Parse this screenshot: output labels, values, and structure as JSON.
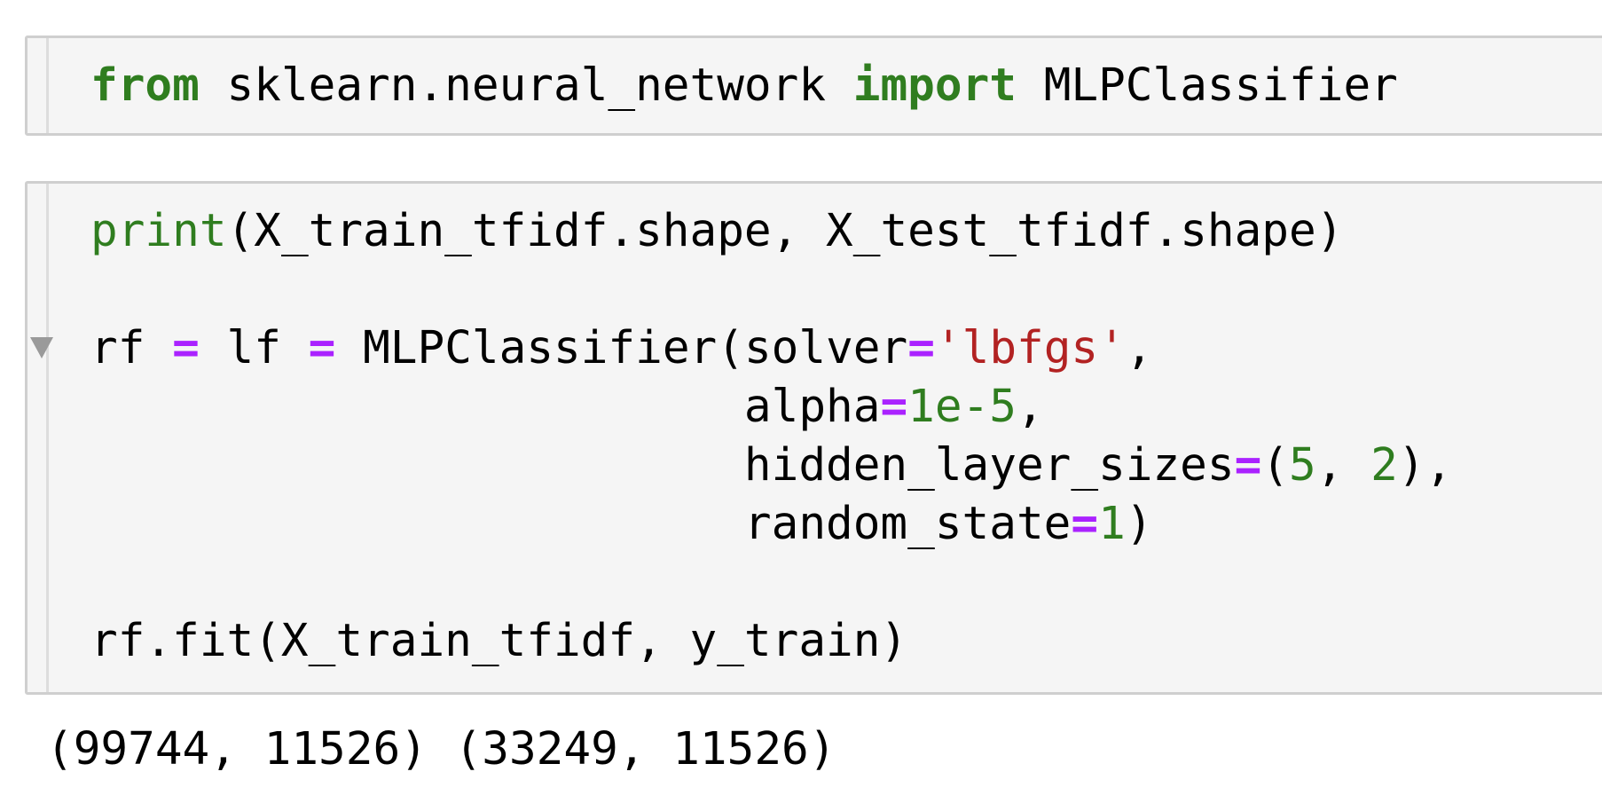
{
  "cells": [
    {
      "lines": [
        [
          {
            "t": "from",
            "c": "kw"
          },
          {
            "t": " sklearn.neural_network ",
            "c": ""
          },
          {
            "t": "import",
            "c": "kw"
          },
          {
            "t": " MLPClassifier",
            "c": ""
          }
        ]
      ]
    },
    {
      "lines": [
        [
          {
            "t": "print",
            "c": "bi"
          },
          {
            "t": "(X_train_tfidf.shape, X_test_tfidf.shape)",
            "c": ""
          }
        ],
        [],
        [
          {
            "t": "rf ",
            "c": ""
          },
          {
            "t": "=",
            "c": "op"
          },
          {
            "t": " lf ",
            "c": ""
          },
          {
            "t": "=",
            "c": "op"
          },
          {
            "t": " MLPClassifier(solver",
            "c": ""
          },
          {
            "t": "=",
            "c": "op"
          },
          {
            "t": "'lbfgs'",
            "c": "str"
          },
          {
            "t": ",",
            "c": ""
          }
        ],
        [
          {
            "t": "                        alpha",
            "c": ""
          },
          {
            "t": "=",
            "c": "op"
          },
          {
            "t": "1e-5",
            "c": "num"
          },
          {
            "t": ",",
            "c": ""
          }
        ],
        [
          {
            "t": "                        hidden_layer_sizes",
            "c": ""
          },
          {
            "t": "=",
            "c": "op"
          },
          {
            "t": "(",
            "c": ""
          },
          {
            "t": "5",
            "c": "num"
          },
          {
            "t": ", ",
            "c": ""
          },
          {
            "t": "2",
            "c": "num"
          },
          {
            "t": "),",
            "c": ""
          }
        ],
        [
          {
            "t": "                        random_state",
            "c": ""
          },
          {
            "t": "=",
            "c": "op"
          },
          {
            "t": "1",
            "c": "num"
          },
          {
            "t": ")",
            "c": ""
          }
        ],
        [],
        [
          {
            "t": "rf.fit(X_train_tfidf, y_train)",
            "c": ""
          }
        ]
      ]
    }
  ],
  "output": "(99744, 11526) (33249, 11526)",
  "colors": {
    "keyword": "#2f7d1f",
    "builtin": "#2f7d1f",
    "operator": "#aa22ff",
    "string": "#b22222",
    "number": "#2f7d1f",
    "cell_background": "#f5f5f5",
    "cell_border": "#cfcfcf"
  },
  "icons": {
    "fold": "collapse-triangle-icon"
  }
}
